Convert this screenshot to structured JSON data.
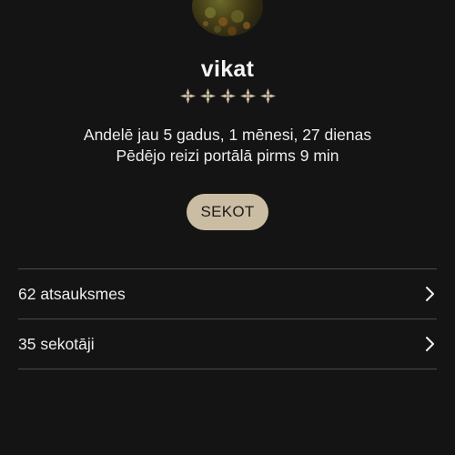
{
  "profile": {
    "username": "vikat",
    "rating_stars": 5,
    "member_since": "Andelē jau 5 gadus, 1 mēnesi, 27 dienas",
    "last_seen": "Pēdējo reizi portālā pirms 9 min"
  },
  "actions": {
    "follow_label": "SEKOT"
  },
  "links": [
    {
      "label": "62 atsauksmes",
      "icon": "chevron-right-icon"
    },
    {
      "label": "35 sekotāji",
      "icon": "chevron-right-icon"
    }
  ],
  "colors": {
    "background": "#141414",
    "accent": "#cbbda3",
    "text": "#eeeeee",
    "divider": "#4a4a4a"
  }
}
